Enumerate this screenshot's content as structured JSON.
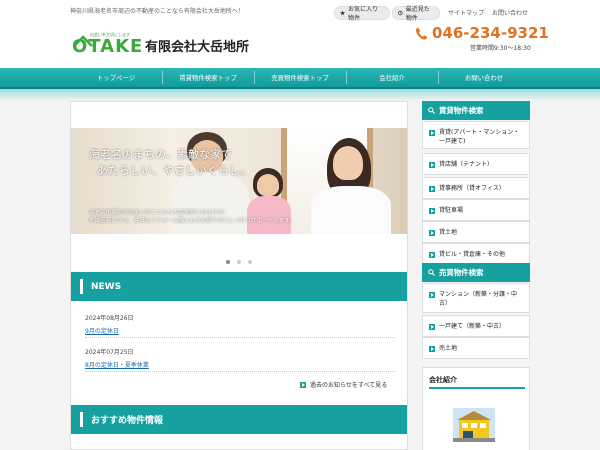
{
  "topbar": {
    "tagline": "神奈川県海老名市周辺の不動産のことなら有限会社大岳地所へ！",
    "favorites_label": "お気に入り物件",
    "recent_label": "最近見た物件",
    "sitemap_label": "サイトマップ",
    "separator": "|",
    "contact_label": "お問い合わせ"
  },
  "header": {
    "logo_tagline": "出会いを大切にします",
    "logo_text": "OTAKE",
    "company_name": "有限会社大岳地所",
    "phone": "046-234-9321",
    "hours": "営業時間9:30～18:30"
  },
  "nav": {
    "items": [
      {
        "label": "トップページ"
      },
      {
        "label": "賃貸物件検索トップ"
      },
      {
        "label": "売買物件検索トップ"
      },
      {
        "label": "会社紹介"
      },
      {
        "label": "お問い合わせ"
      }
    ]
  },
  "slider": {
    "headline_line1": "海老名のまちの、素敵な家で",
    "headline_line2": "あたらしい、やさしいくらし。",
    "caption_line1": "海老名市周辺の住まいのことなら大岳地所におまかせ！",
    "caption_line2": "地域密着だから、賃貸もリフォーム購入もきめ細やかにしっかりサポートします。"
  },
  "news": {
    "title": "NEWS",
    "items": [
      {
        "date": "2024年08月26日",
        "link": "9月の定休日"
      },
      {
        "date": "2024年07月25日",
        "link": "8月の定休日・夏季休業"
      }
    ],
    "more_label": "過去のお知らせをすべて見る"
  },
  "recommended": {
    "title": "おすすめ物件情報"
  },
  "sidebar": {
    "rental_title": "賃貸物件検索",
    "rental_items": [
      {
        "label": "賃貸(アパート・マンション・一戸建て)"
      },
      {
        "label": "貸店舗（テナント）"
      },
      {
        "label": "貸事務所（貸オフィス）"
      },
      {
        "label": "貸駐車場"
      },
      {
        "label": "貸土地"
      },
      {
        "label": "貸ビル・貸倉庫・その他"
      }
    ],
    "sale_title": "売買物件検索",
    "sale_items": [
      {
        "label": "マンション（新築・分譲・中古）"
      },
      {
        "label": "一戸建て（新築・中古）"
      },
      {
        "label": "売土地"
      }
    ],
    "company_title": "会社紹介"
  },
  "colors": {
    "teal": "#17a0a0",
    "phone_orange": "#e2711d",
    "logo_green": "#3aaa3a",
    "link_blue": "#1a6bb0"
  }
}
